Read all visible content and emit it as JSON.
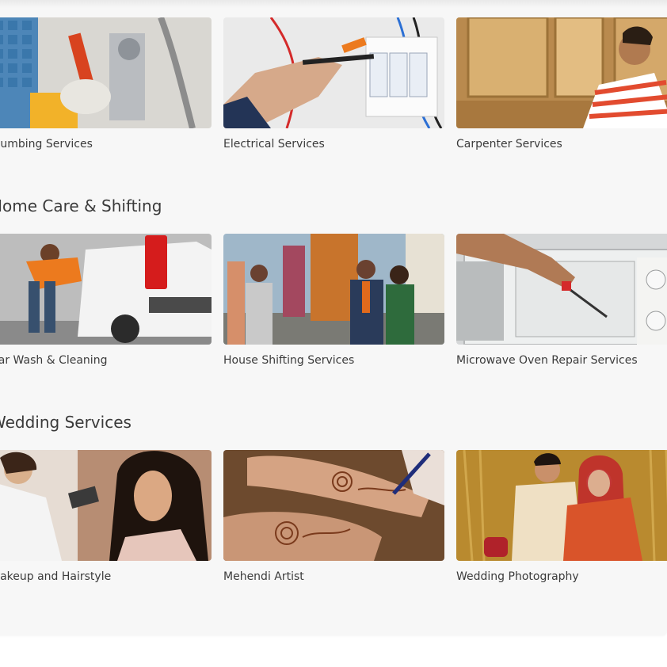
{
  "sections": [
    {
      "title": "",
      "cards": [
        {
          "label": "Plumbing Services",
          "image": "plumber-wrench-photo"
        },
        {
          "label": "Electrical Services",
          "image": "electrician-wiring-photo"
        },
        {
          "label": "Carpenter Services",
          "image": "carpenter-cabinet-photo"
        }
      ]
    },
    {
      "title": "Home Care & Shifting",
      "cards": [
        {
          "label": "Car Wash & Cleaning",
          "image": "car-wash-photo"
        },
        {
          "label": "House Shifting Services",
          "image": "house-shifting-handshake-photo"
        },
        {
          "label": "Microwave Oven Repair Services",
          "image": "microwave-repair-photo"
        }
      ]
    },
    {
      "title": "Wedding Services",
      "cards": [
        {
          "label": "Makeup and Hairstyle",
          "image": "makeup-artist-photo"
        },
        {
          "label": "Mehendi Artist",
          "image": "mehendi-hands-photo"
        },
        {
          "label": "Wedding Photography",
          "image": "wedding-couple-photo"
        }
      ]
    }
  ]
}
